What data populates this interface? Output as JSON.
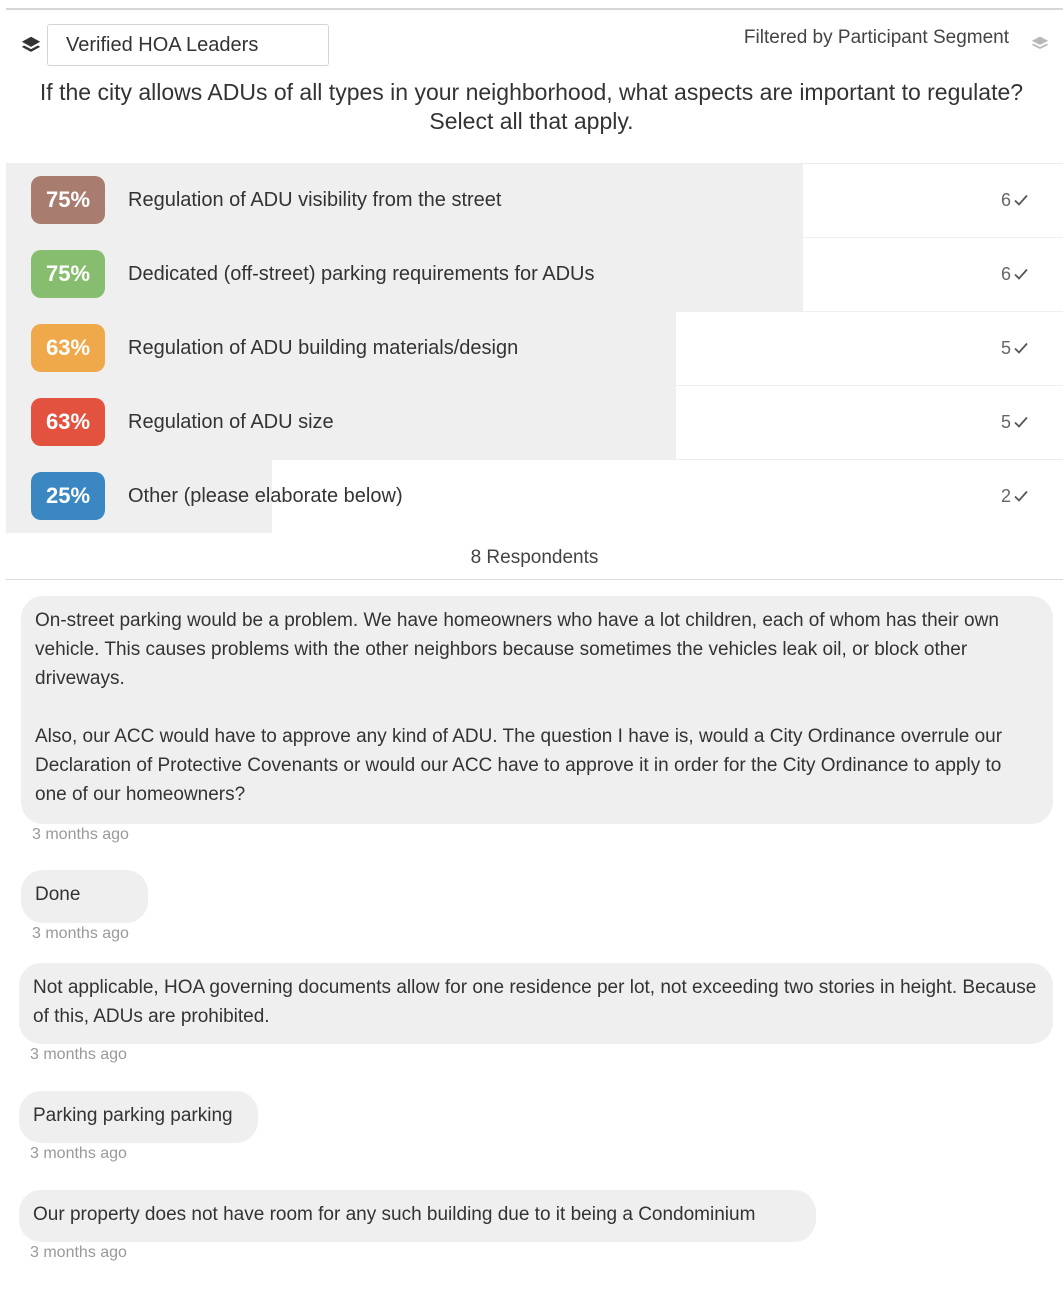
{
  "header": {
    "segment_selected": "Verified HOA Leaders",
    "filter_label": "Filtered by Participant Segment"
  },
  "question": {
    "line1": "If the city allows ADUs of all types in your neighborhood, what aspects are important to regulate?",
    "line2": "Select all that apply."
  },
  "results": [
    {
      "percent_label": "75%",
      "fraction": 0.75,
      "label": "Regulation of ADU visibility from the street",
      "count": "6",
      "color": "#a87d70"
    },
    {
      "percent_label": "75%",
      "fraction": 0.75,
      "label": "Dedicated (off-street) parking requirements for ADUs",
      "count": "6",
      "color": "#86bd6e"
    },
    {
      "percent_label": "63%",
      "fraction": 0.63,
      "label": "Regulation of ADU building materials/design",
      "count": "5",
      "color": "#efa84a"
    },
    {
      "percent_label": "63%",
      "fraction": 0.63,
      "label": "Regulation of ADU size",
      "count": "5",
      "color": "#e2523f"
    },
    {
      "percent_label": "25%",
      "fraction": 0.25,
      "label": "Other (please elaborate below)",
      "count": "2",
      "color": "#3a87c2"
    }
  ],
  "respondents_label": "8 Respondents",
  "comments": [
    {
      "paragraphs": [
        "On-street parking would be a problem. We have homeowners who have a lot children, each of whom has their own vehicle. This causes problems with the other neighbors because sometimes the vehicles leak oil, or block other driveways.",
        "Also, our ACC would have to approve any kind of ADU. The question I have is, would a City Ordinance overrule our Declaration of Protective Covenants or would our ACC have to approve it in order for the City Ordinance to apply to one of our homeowners?"
      ],
      "time": "3 months ago"
    },
    {
      "paragraphs": [
        "Done"
      ],
      "time": "3 months ago"
    },
    {
      "paragraphs": [
        "Not applicable, HOA governing documents allow for one residence per lot, not exceeding two stories in height. Because of this, ADUs are prohibited."
      ],
      "time": "3 months ago"
    },
    {
      "paragraphs": [
        "Parking parking parking"
      ],
      "time": "3 months ago"
    },
    {
      "paragraphs": [
        "Our property does not have room for any such building due to it being a Condominium"
      ],
      "time": "3 months ago"
    }
  ],
  "icons": {
    "segment": "layers-icon",
    "filter": "layers-filter-icon",
    "count": "check-icon"
  }
}
